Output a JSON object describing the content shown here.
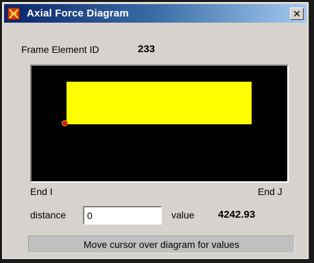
{
  "window": {
    "title": "Axial Force Diagram",
    "close_label": "✕",
    "accent_color": "#0a246a"
  },
  "frame": {
    "label": "Frame Element ID",
    "id": "233"
  },
  "diagram": {
    "background_color": "#000000",
    "bar_color": "#ffff00",
    "marker_color": "#cc2200",
    "end_i_label": "End I",
    "end_j_label": "End J"
  },
  "distance": {
    "label": "distance",
    "value": "0"
  },
  "value": {
    "label": "value",
    "number": "4242.93"
  },
  "status": {
    "text": "Move cursor over diagram for values"
  }
}
